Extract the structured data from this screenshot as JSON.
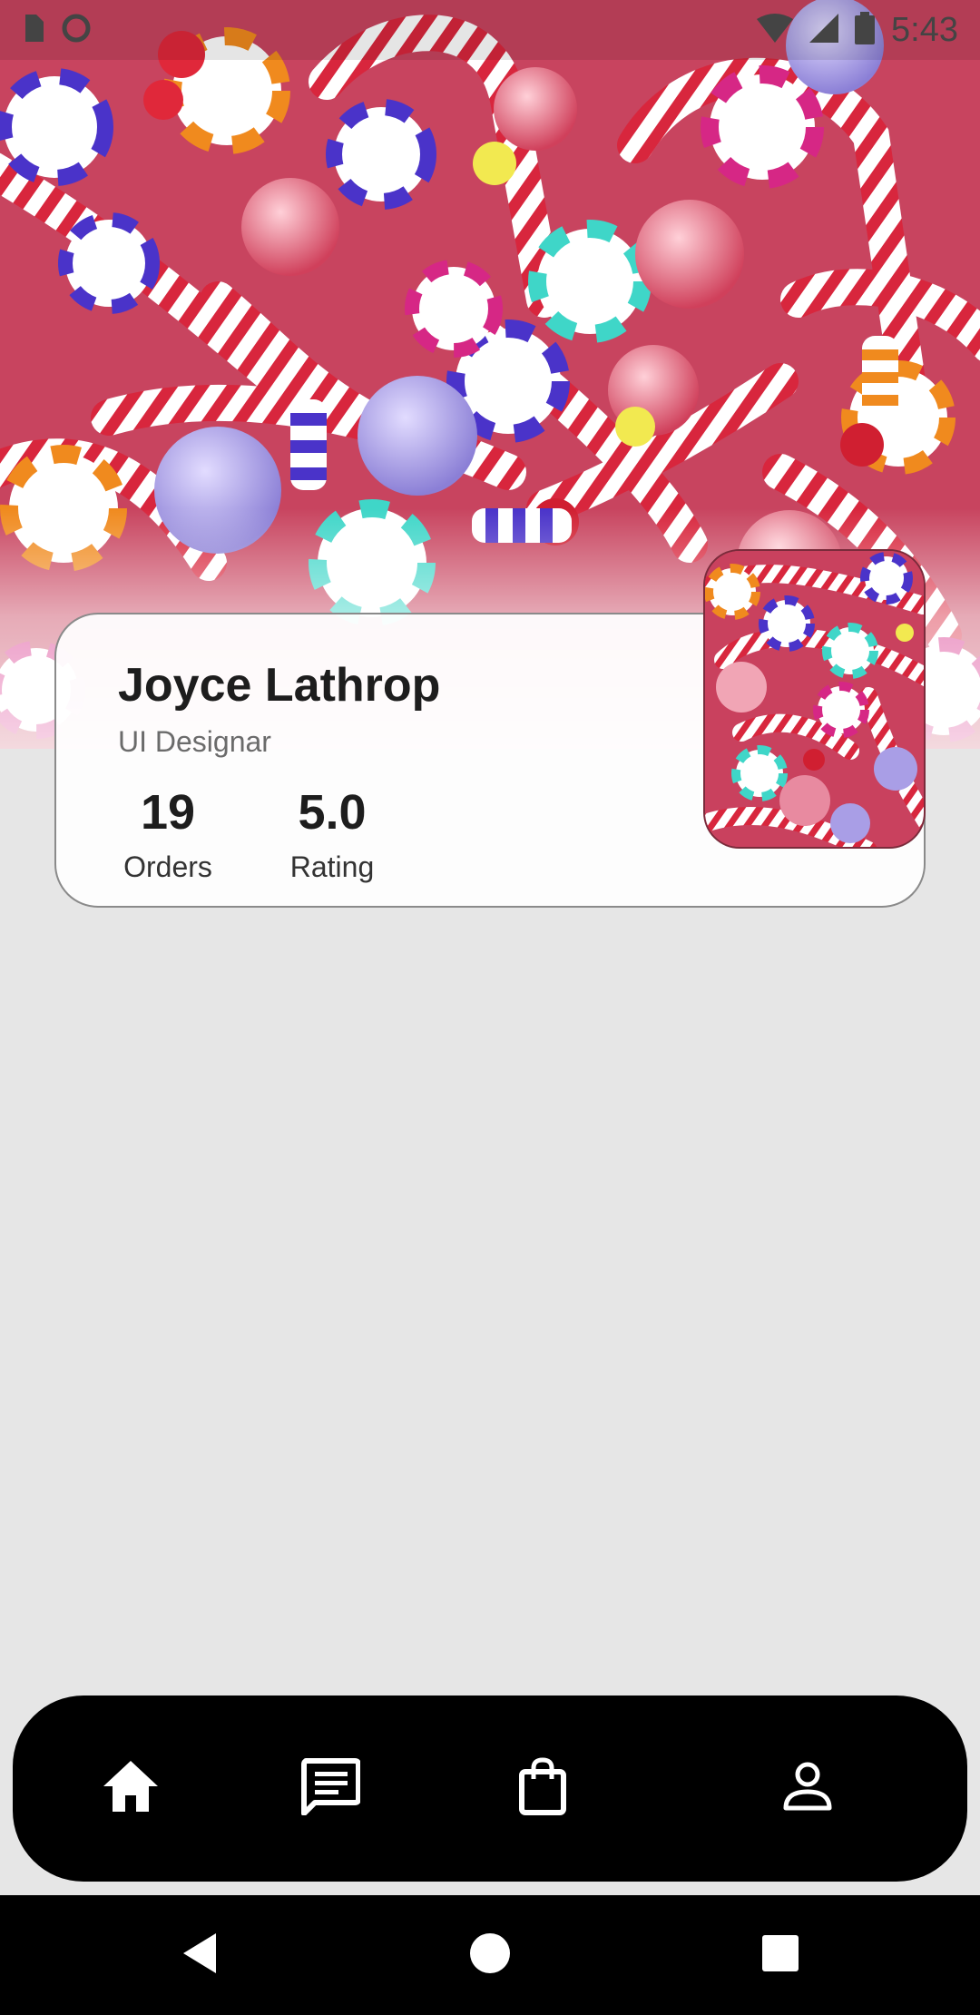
{
  "status_bar": {
    "time": "5:43",
    "icons": [
      "sim-card-icon",
      "circle-status-icon",
      "wifi-icon",
      "signal-icon",
      "battery-icon"
    ]
  },
  "profile": {
    "name": "Joyce Lathrop",
    "role": "UI Designar",
    "stats": [
      {
        "value": "19",
        "label": "Orders"
      },
      {
        "value": "5.0",
        "label": "Rating"
      }
    ]
  },
  "bottom_nav": {
    "items": [
      {
        "icon": "home-icon",
        "active": true
      },
      {
        "icon": "chat-icon",
        "active": false
      },
      {
        "icon": "shopping-bag-icon",
        "active": false
      },
      {
        "icon": "person-icon",
        "active": false
      }
    ]
  },
  "system_nav": {
    "buttons": [
      "back-icon",
      "home-circle-icon",
      "recents-icon"
    ]
  },
  "colors": {
    "background": "#e6e6e6",
    "nav_bar": "#000000",
    "candy_red": "#d93a4f",
    "candy_purple": "#5a3fd0",
    "candy_teal": "#3fd6c8"
  }
}
